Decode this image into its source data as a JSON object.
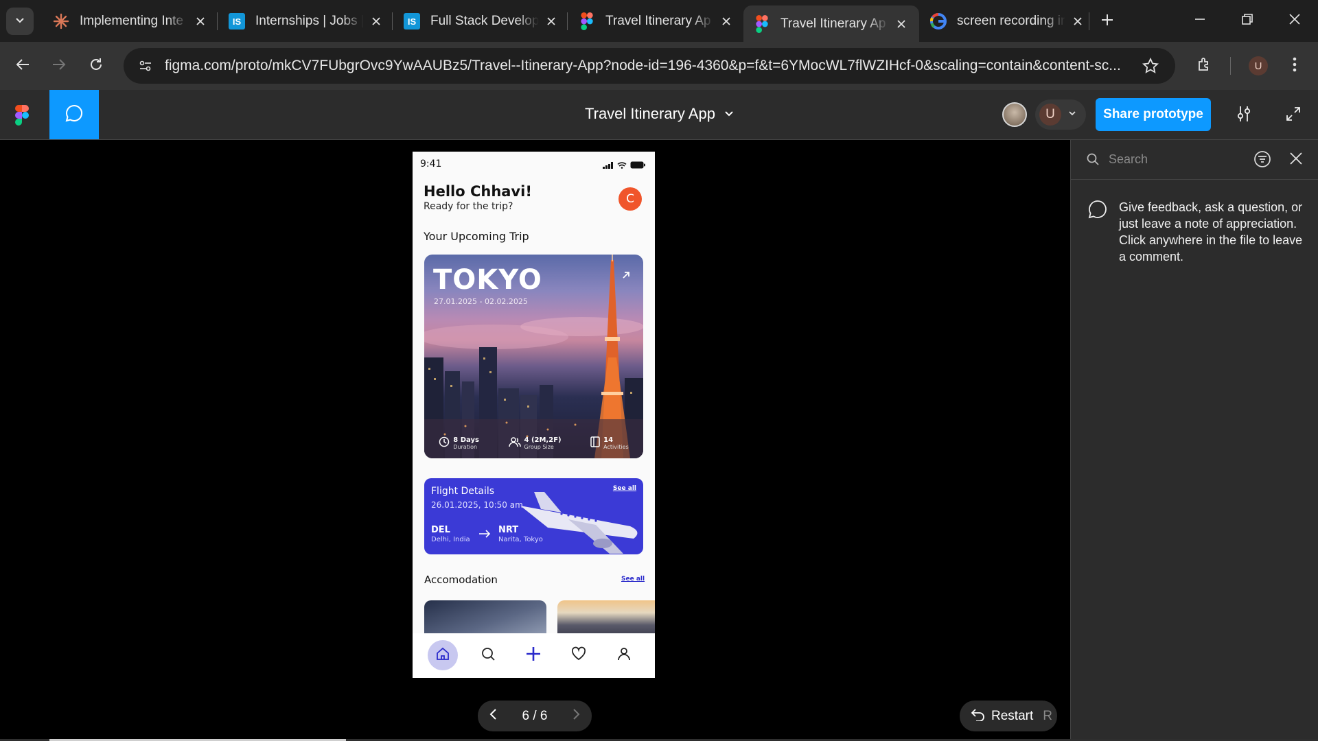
{
  "browser": {
    "tabs": [
      {
        "title": "Implementing Inte",
        "icon": "claude-icon"
      },
      {
        "title": "Internships | Jobs |",
        "icon": "internshala-icon"
      },
      {
        "title": "Full Stack Develop",
        "icon": "internshala-icon"
      },
      {
        "title": "Travel Itinerary Ap",
        "icon": "figma-icon"
      },
      {
        "title": "Travel Itinerary Ap",
        "icon": "figma-icon",
        "active": true
      },
      {
        "title": "screen recording ir",
        "icon": "google-icon"
      }
    ],
    "url": "figma.com/proto/mkCV7FUbgrOvc9YwAAUBz5/Travel--Itinerary-App?node-id=196-4360&p=f&t=6YMocWL7flWZIHcf-0&scaling=contain&content-sc...",
    "profile_initial": "U"
  },
  "figma": {
    "file_title": "Travel Itinerary App",
    "user_initial": "U",
    "share_label": "Share prototype",
    "comments": {
      "search_placeholder": "Search",
      "hint": "Give feedback, ask a question, or just leave a note of appreciation. Click anywhere in the file to leave a comment."
    },
    "pager": {
      "label": "6 / 6"
    },
    "restart": {
      "label": "Restart",
      "shortcut": "R"
    }
  },
  "app": {
    "time": "9:41",
    "greeting": "Hello Chhavi!",
    "subtitle": "Ready for the trip?",
    "avatar_initial": "C",
    "upcoming_title": "Your Upcoming Trip",
    "trip": {
      "city": "TOKYO",
      "dates": "27.01.2025 - 02.02.2025",
      "stats": [
        {
          "value": "8 Days",
          "label": "Duration",
          "icon": "clock-icon"
        },
        {
          "value": "4 (2M,2F)",
          "label": "Group Size",
          "icon": "group-icon"
        },
        {
          "value": "14",
          "label": "Activities",
          "icon": "activities-icon"
        }
      ]
    },
    "flight": {
      "title": "Flight Details",
      "see_all": "See all",
      "datetime": "26.01.2025, 10:50 am",
      "from_code": "DEL",
      "from_city": "Delhi, India",
      "to_code": "NRT",
      "to_city": "Narita, Tokyo"
    },
    "accommodation": {
      "title": "Accomodation",
      "see_all": "See all"
    },
    "accent": "#3b3ad6"
  }
}
